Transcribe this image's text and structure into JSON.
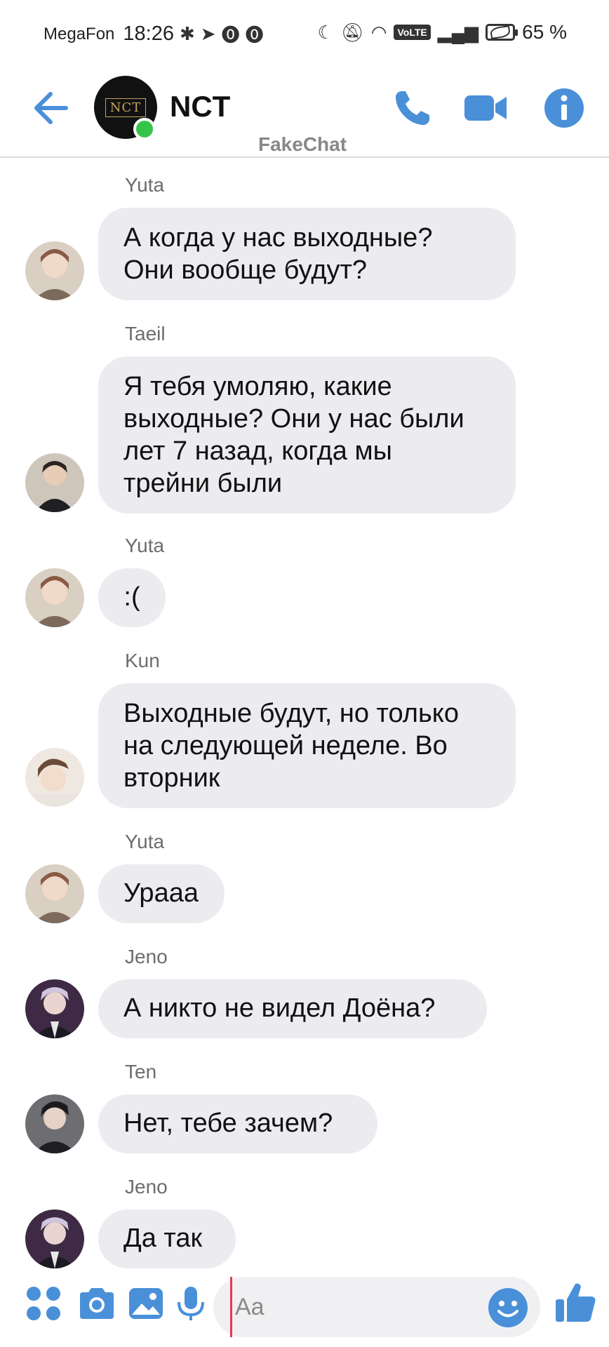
{
  "status_bar": {
    "carrier": "MegaFon",
    "time": "18:26",
    "battery": "65 %",
    "network": "VoLTE"
  },
  "header": {
    "title": "NCT",
    "watermark": "FakeChat",
    "avatar_logo": "NCT",
    "accent_color": "#4a90d9"
  },
  "messages": [
    {
      "sender": "Yuta",
      "text": "А когда у нас выходные?\nОни вообще будут?"
    },
    {
      "sender": "Taeil",
      "text": "Я тебя умоляю, какие\nвыходные? Они у нас были\nлет 7 назад, когда мы\nтрейни были"
    },
    {
      "sender": "Yuta",
      "text": ":("
    },
    {
      "sender": "Kun",
      "text": "Выходные будут, но только\nна следующей неделе. Во\nвторник"
    },
    {
      "sender": "Yuta",
      "text": "Урааа"
    },
    {
      "sender": "Jeno",
      "text": "А никто не видел Доёна?"
    },
    {
      "sender": "Ten",
      "text": "Нет, тебе зачем?"
    },
    {
      "sender": "Jeno",
      "text": "Да так"
    }
  ],
  "input": {
    "placeholder": "Aa"
  }
}
